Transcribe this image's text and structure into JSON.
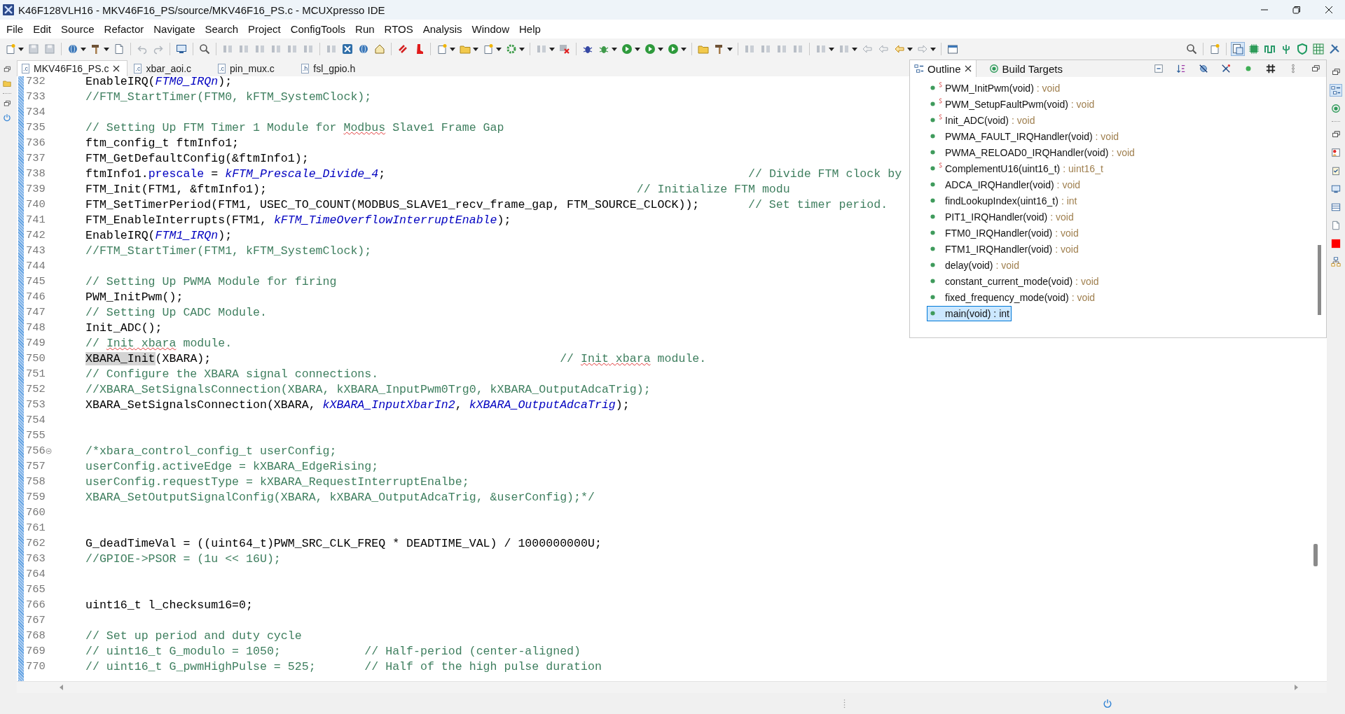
{
  "window": {
    "title": "K46F128VLH16 - MKV46F16_PS/source/MKV46F16_PS.c - MCUXpresso IDE"
  },
  "menu": [
    "File",
    "Edit",
    "Source",
    "Refactor",
    "Navigate",
    "Search",
    "Project",
    "ConfigTools",
    "Run",
    "RTOS",
    "Analysis",
    "Window",
    "Help"
  ],
  "editor_tabs": [
    {
      "label": "MKV46F16_PS.c",
      "icon_letter": ".c",
      "selected": true
    },
    {
      "label": "xbar_aoi.c",
      "icon_letter": ".c",
      "selected": false
    },
    {
      "label": "pin_mux.c",
      "icon_letter": ".c",
      "selected": false
    },
    {
      "label": "fsl_gpio.h",
      "icon_letter": ".h",
      "selected": false
    }
  ],
  "code_lines": [
    {
      "number": "732",
      "fold": false,
      "tokens": [
        {
          "kind": "plain",
          "text": "EnableIRQ("
        },
        {
          "kind": "enum",
          "text": "FTM0_IRQn"
        },
        {
          "kind": "plain",
          "text": ");"
        }
      ]
    },
    {
      "number": "733",
      "fold": false,
      "tokens": [
        {
          "kind": "comment",
          "text": "//FTM_StartTimer(FTM0, kFTM_SystemClock);"
        }
      ]
    },
    {
      "number": "734",
      "fold": false
    },
    {
      "number": "735",
      "fold": false,
      "tokens": [
        {
          "kind": "comment",
          "text": "// Setting Up FTM Timer 1 Module for "
        },
        {
          "kind": "misspelled",
          "text": "Modbus"
        },
        {
          "kind": "comment",
          "text": " Slave1 Frame Gap"
        }
      ]
    },
    {
      "number": "736",
      "fold": false,
      "tokens": [
        {
          "kind": "plain",
          "text": "ftm_config_t ftmInfo1;"
        }
      ]
    },
    {
      "number": "737",
      "fold": false,
      "tokens": [
        {
          "kind": "plain",
          "text": "FTM_GetDefaultConfig(&ftmInfo1);"
        }
      ]
    },
    {
      "number": "738",
      "fold": false,
      "tokens": [
        {
          "kind": "plain",
          "text": "ftmInfo1."
        },
        {
          "kind": "field",
          "text": "prescale"
        },
        {
          "kind": "plain",
          "text": " = "
        },
        {
          "kind": "enum",
          "text": "kFTM_Prescale_Divide_4"
        },
        {
          "kind": "plain",
          "text": ";                                                    "
        },
        {
          "kind": "comment",
          "text": "// Divide FTM clock by"
        }
      ]
    },
    {
      "number": "739",
      "fold": false,
      "tokens": [
        {
          "kind": "plain",
          "text": "FTM_Init(FTM1, &ftmInfo1);                                                     "
        },
        {
          "kind": "comment",
          "text": "// Initialize FTM modu"
        }
      ]
    },
    {
      "number": "740",
      "fold": false,
      "tokens": [
        {
          "kind": "plain",
          "text": "FTM_SetTimerPeriod(FTM1, USEC_TO_COUNT(MODBUS_SLAVE1_recv_frame_gap, FTM_SOURCE_CLOCK));       "
        },
        {
          "kind": "comment",
          "text": "// Set timer period."
        }
      ]
    },
    {
      "number": "741",
      "fold": false,
      "tokens": [
        {
          "kind": "plain",
          "text": "FTM_EnableInterrupts(FTM1, "
        },
        {
          "kind": "enum",
          "text": "kFTM_TimeOverflowInterruptEnable"
        },
        {
          "kind": "plain",
          "text": ");"
        }
      ]
    },
    {
      "number": "742",
      "fold": false,
      "tokens": [
        {
          "kind": "plain",
          "text": "EnableIRQ("
        },
        {
          "kind": "enum",
          "text": "FTM1_IRQn"
        },
        {
          "kind": "plain",
          "text": ");"
        }
      ]
    },
    {
      "number": "743",
      "fold": false,
      "tokens": [
        {
          "kind": "comment",
          "text": "//FTM_StartTimer(FTM1, kFTM_SystemClock);"
        }
      ]
    },
    {
      "number": "744",
      "fold": false
    },
    {
      "number": "745",
      "fold": false,
      "tokens": [
        {
          "kind": "comment",
          "text": "// Setting Up PWMA Module for firing"
        }
      ]
    },
    {
      "number": "746",
      "fold": false,
      "tokens": [
        {
          "kind": "plain",
          "text": "PWM_InitPwm();"
        }
      ]
    },
    {
      "number": "747",
      "fold": false,
      "tokens": [
        {
          "kind": "comment",
          "text": "// Setting Up CADC Module."
        }
      ]
    },
    {
      "number": "748",
      "fold": false,
      "tokens": [
        {
          "kind": "plain",
          "text": "Init_ADC();"
        }
      ]
    },
    {
      "number": "749",
      "fold": false,
      "tokens": [
        {
          "kind": "comment",
          "text": "// "
        },
        {
          "kind": "misspelled",
          "text": "Init"
        },
        {
          "kind": "misspelled",
          "text": " xbara"
        },
        {
          "kind": "comment",
          "text": " module."
        }
      ]
    },
    {
      "number": "750",
      "fold": false,
      "tokens": [
        {
          "kind": "occurrence",
          "text": "XBARA_Init"
        },
        {
          "kind": "plain",
          "text": "(XBARA);                                                  "
        },
        {
          "kind": "comment",
          "text": "// "
        },
        {
          "kind": "misspelled",
          "text": "Init"
        },
        {
          "kind": "misspelled",
          "text": " xbara"
        },
        {
          "kind": "comment",
          "text": " module."
        }
      ]
    },
    {
      "number": "751",
      "fold": false,
      "tokens": [
        {
          "kind": "comment",
          "text": "// Configure the XBARA signal connections."
        }
      ]
    },
    {
      "number": "752",
      "fold": false,
      "tokens": [
        {
          "kind": "comment",
          "text": "//XBARA_SetSignalsConnection(XBARA, kXBARA_InputPwm0Trg0, kXBARA_OutputAdcaTrig);"
        }
      ]
    },
    {
      "number": "753",
      "fold": false,
      "tokens": [
        {
          "kind": "plain",
          "text": "XBARA_SetSignalsConnection(XBARA, "
        },
        {
          "kind": "enum",
          "text": "kXBARA_InputXbarIn2"
        },
        {
          "kind": "plain",
          "text": ", "
        },
        {
          "kind": "enum",
          "text": "kXBARA_OutputAdcaTrig"
        },
        {
          "kind": "plain",
          "text": ");"
        }
      ]
    },
    {
      "number": "754",
      "fold": false
    },
    {
      "number": "755",
      "fold": false
    },
    {
      "number": "756",
      "fold": true,
      "tokens": [
        {
          "kind": "comment",
          "text": "/*xbara_control_config_t userConfig;"
        }
      ]
    },
    {
      "number": "757",
      "fold": false,
      "tokens": [
        {
          "kind": "comment",
          "text": "userConfig.activeEdge = kXBARA_EdgeRising;"
        }
      ]
    },
    {
      "number": "758",
      "fold": false,
      "tokens": [
        {
          "kind": "comment",
          "text": "userConfig.requestType = kXBARA_RequestInterruptEnalbe;"
        }
      ]
    },
    {
      "number": "759",
      "fold": false,
      "tokens": [
        {
          "kind": "comment",
          "text": "XBARA_SetOutputSignalConfig(XBARA, kXBARA_OutputAdcaTrig, &userConfig);*/"
        }
      ]
    },
    {
      "number": "760",
      "fold": false
    },
    {
      "number": "761",
      "fold": false
    },
    {
      "number": "762",
      "fold": false,
      "tokens": [
        {
          "kind": "plain",
          "text": "G_deadTimeVal = ((uint64_t)PWM_SRC_CLK_FREQ * DEADTIME_VAL) / 1000000000U;"
        }
      ]
    },
    {
      "number": "763",
      "fold": false,
      "tokens": [
        {
          "kind": "comment",
          "text": "//GPIOE->PSOR = (1u << 16U);"
        }
      ]
    },
    {
      "number": "764",
      "fold": false
    },
    {
      "number": "765",
      "fold": false
    },
    {
      "number": "766",
      "fold": false,
      "tokens": [
        {
          "kind": "plain",
          "text": "uint16_t l_checksum16=0;"
        }
      ]
    },
    {
      "number": "767",
      "fold": false
    },
    {
      "number": "768",
      "fold": false,
      "tokens": [
        {
          "kind": "comment",
          "text": "// Set up period and duty cycle"
        }
      ]
    },
    {
      "number": "769",
      "fold": false,
      "tokens": [
        {
          "kind": "comment",
          "text": "// uint16_t G_modulo = 1050;            // Half-period (center-aligned)"
        }
      ]
    },
    {
      "number": "770",
      "fold": false,
      "tokens": [
        {
          "kind": "comment",
          "text": "// uint16_t G_pwmHighPulse = 525;       // Half of the high pulse duration"
        }
      ]
    }
  ],
  "outline": {
    "tabs": [
      {
        "label": "Outline",
        "selected": true
      },
      {
        "label": "Build Targets",
        "selected": false
      }
    ],
    "items": [
      {
        "name": "PWM_InitPwm(void)",
        "return_type": ": void",
        "static": true,
        "selected": false
      },
      {
        "name": "PWM_SetupFaultPwm(void)",
        "return_type": ": void",
        "static": true,
        "selected": false
      },
      {
        "name": "Init_ADC(void)",
        "return_type": ": void",
        "static": true,
        "selected": false
      },
      {
        "name": "PWMA_FAULT_IRQHandler(void)",
        "return_type": ": void",
        "static": false,
        "selected": false
      },
      {
        "name": "PWMA_RELOAD0_IRQHandler(void)",
        "return_type": ": void",
        "static": false,
        "selected": false
      },
      {
        "name": "ComplementU16(uint16_t)",
        "return_type": ": uint16_t",
        "static": true,
        "selected": false
      },
      {
        "name": "ADCA_IRQHandler(void)",
        "return_type": ": void",
        "static": false,
        "selected": false
      },
      {
        "name": "findLookupIndex(uint16_t)",
        "return_type": ": int",
        "static": false,
        "selected": false
      },
      {
        "name": "PIT1_IRQHandler(void)",
        "return_type": ": void",
        "static": false,
        "selected": false
      },
      {
        "name": "FTM0_IRQHandler(void)",
        "return_type": ": void",
        "static": false,
        "selected": false
      },
      {
        "name": "FTM1_IRQHandler(void)",
        "return_type": ": void",
        "static": false,
        "selected": false
      },
      {
        "name": "delay(void)",
        "return_type": ": void",
        "static": false,
        "selected": false
      },
      {
        "name": "constant_current_mode(void)",
        "return_type": ": void",
        "static": false,
        "selected": false
      },
      {
        "name": "fixed_frequency_mode(void)",
        "return_type": ": void",
        "static": false,
        "selected": false
      },
      {
        "name": "main(void)",
        "return_type": ": int",
        "static": false,
        "selected": true
      }
    ]
  }
}
